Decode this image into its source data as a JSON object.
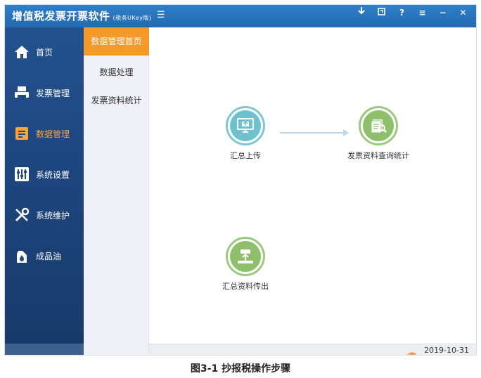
{
  "app": {
    "title": "增值税发票开票软件",
    "title_suffix": "(税务UKey版)",
    "window_controls": [
      "download-icon",
      "restore-icon",
      "help-icon",
      "menu-icon",
      "minimize-icon",
      "close-icon"
    ]
  },
  "sidebar": {
    "items": [
      {
        "label": "首页",
        "icon": "home-icon",
        "active": false
      },
      {
        "label": "发票管理",
        "icon": "printer-icon",
        "active": false
      },
      {
        "label": "数据管理",
        "icon": "database-icon",
        "active": true
      },
      {
        "label": "系统设置",
        "icon": "sliders-icon",
        "active": false
      },
      {
        "label": "系统维护",
        "icon": "tools-icon",
        "active": false
      },
      {
        "label": "成品油",
        "icon": "oil-can-icon",
        "active": false
      }
    ],
    "active_color": "#f7a53a"
  },
  "submenu": {
    "items": [
      {
        "label": "数据管理首页",
        "active": true
      },
      {
        "label": "数据处理",
        "active": false
      },
      {
        "label": "发票资料统计",
        "active": false
      }
    ],
    "active_color": "#f39a2a"
  },
  "main": {
    "functions": [
      {
        "label": "汇总上传",
        "icon": "upload-monitor-icon",
        "color": "#6cc3cf"
      },
      {
        "label": "发票资料查询统计",
        "icon": "search-documents-icon",
        "color": "#8ec06c"
      },
      {
        "label": "汇总资料传出",
        "icon": "export-data-icon",
        "color": "#8ec06c"
      }
    ]
  },
  "status": {
    "date": "2019-10-31",
    "icon": "signal-icon"
  },
  "caption": "图3-1 抄报税操作步骤",
  "colors": {
    "titlebar": "#2a76bf",
    "sidebar": "#1c4278"
  }
}
